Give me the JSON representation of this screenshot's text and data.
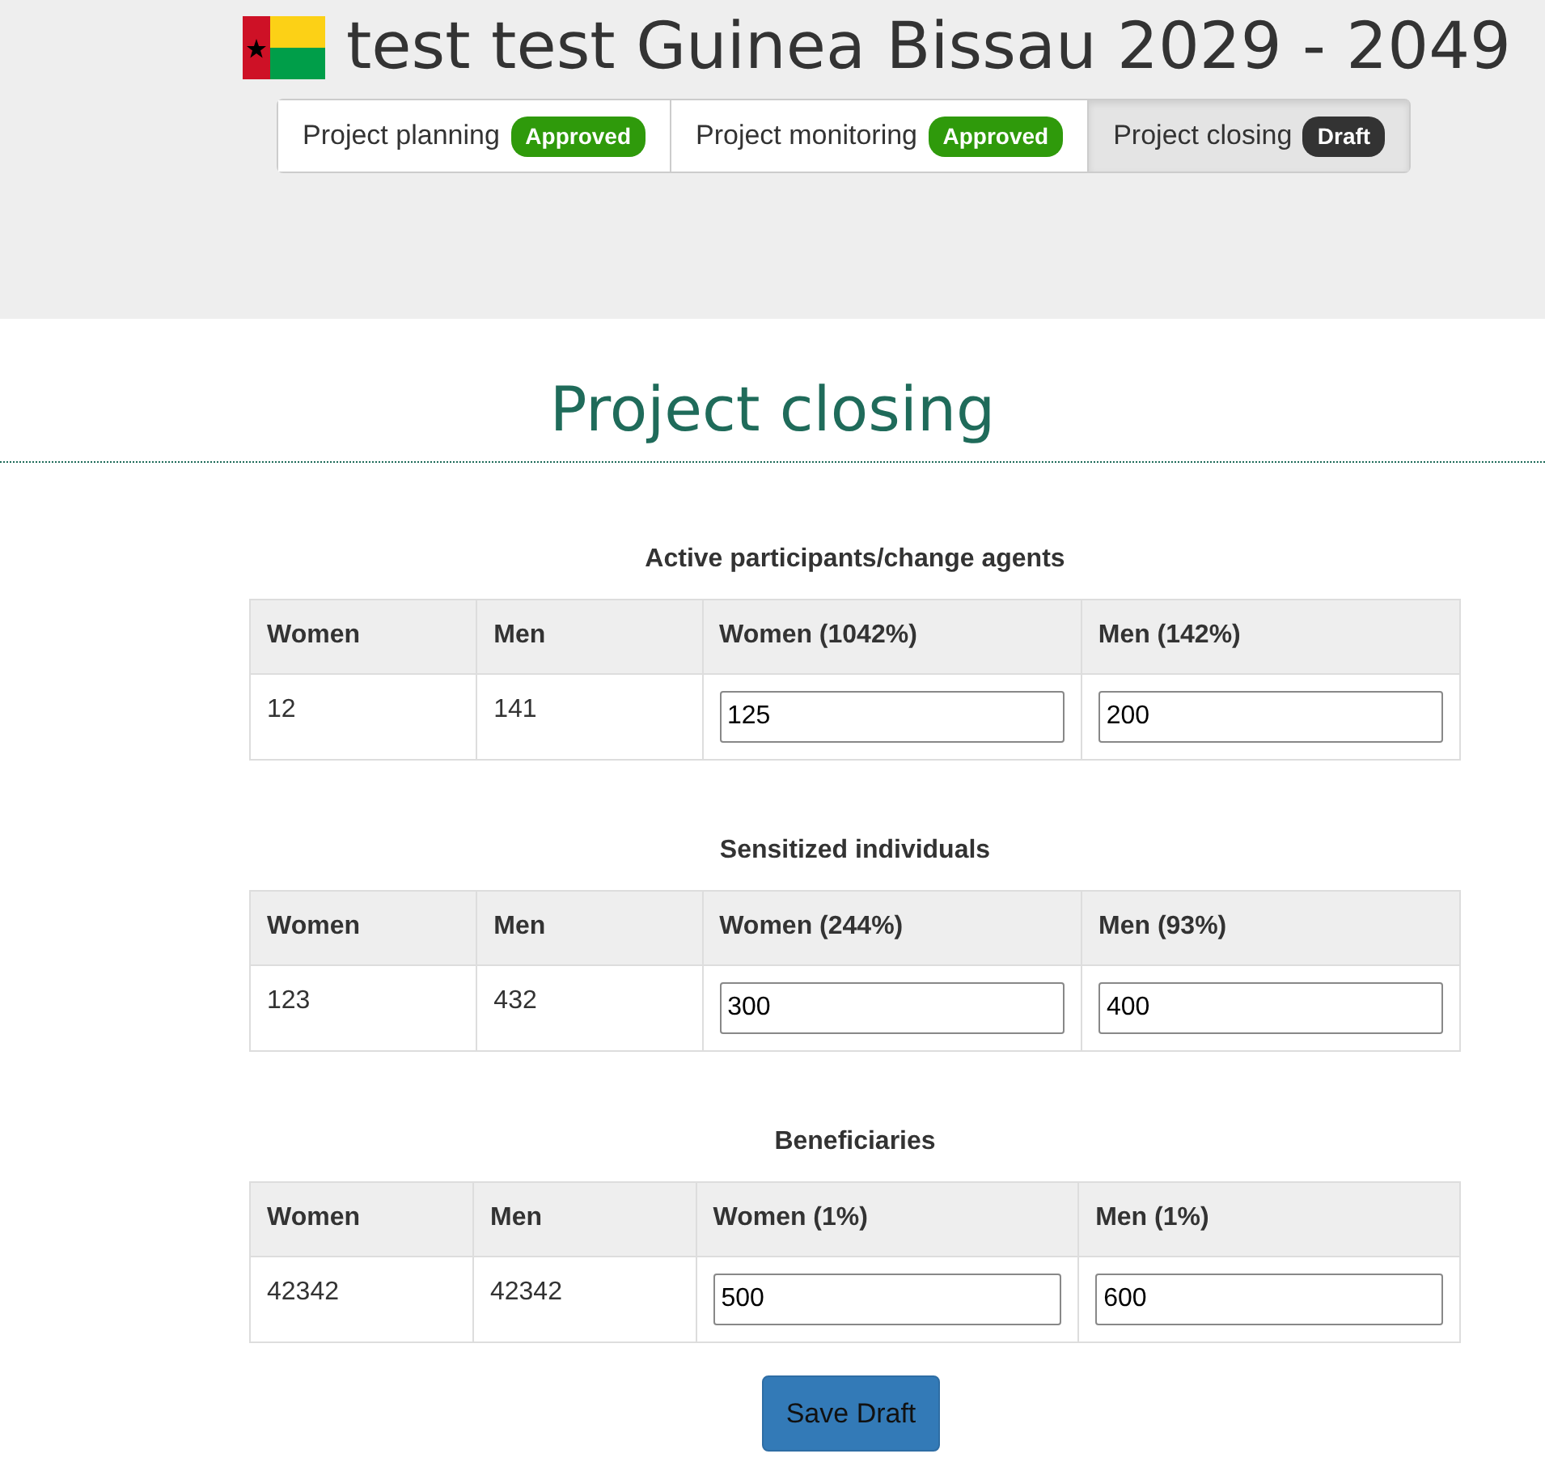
{
  "header": {
    "title": "test test Guinea Bissau 2029 - 2049"
  },
  "tabs": [
    {
      "label": "Project planning",
      "badge": "Approved",
      "color": "#2f9a0b",
      "selected": false
    },
    {
      "label": "Project monitoring",
      "badge": "Approved",
      "color": "#2f9a0b",
      "selected": false
    },
    {
      "label": "Project closing",
      "badge": "Draft",
      "color": "#333333",
      "selected": true
    }
  ],
  "heading": "Project closing",
  "tables": [
    {
      "caption": "Active participants/change agents",
      "columns": [
        "Women",
        "Men",
        "Women (1042%)",
        "Men (142%)"
      ],
      "row": [
        "12",
        "141",
        "125",
        "200"
      ]
    },
    {
      "caption": "Sensitized individuals",
      "columns": [
        "Women",
        "Men",
        "Women (244%)",
        "Men (93%)"
      ],
      "row": [
        "123",
        "432",
        "300",
        "400"
      ]
    },
    {
      "caption": "Beneficiaries",
      "columns": [
        "Women",
        "Men",
        "Women (1%)",
        "Men (1%)"
      ],
      "row": [
        "42342",
        "42342",
        "500",
        "600"
      ]
    }
  ],
  "save_button": "Save Draft"
}
